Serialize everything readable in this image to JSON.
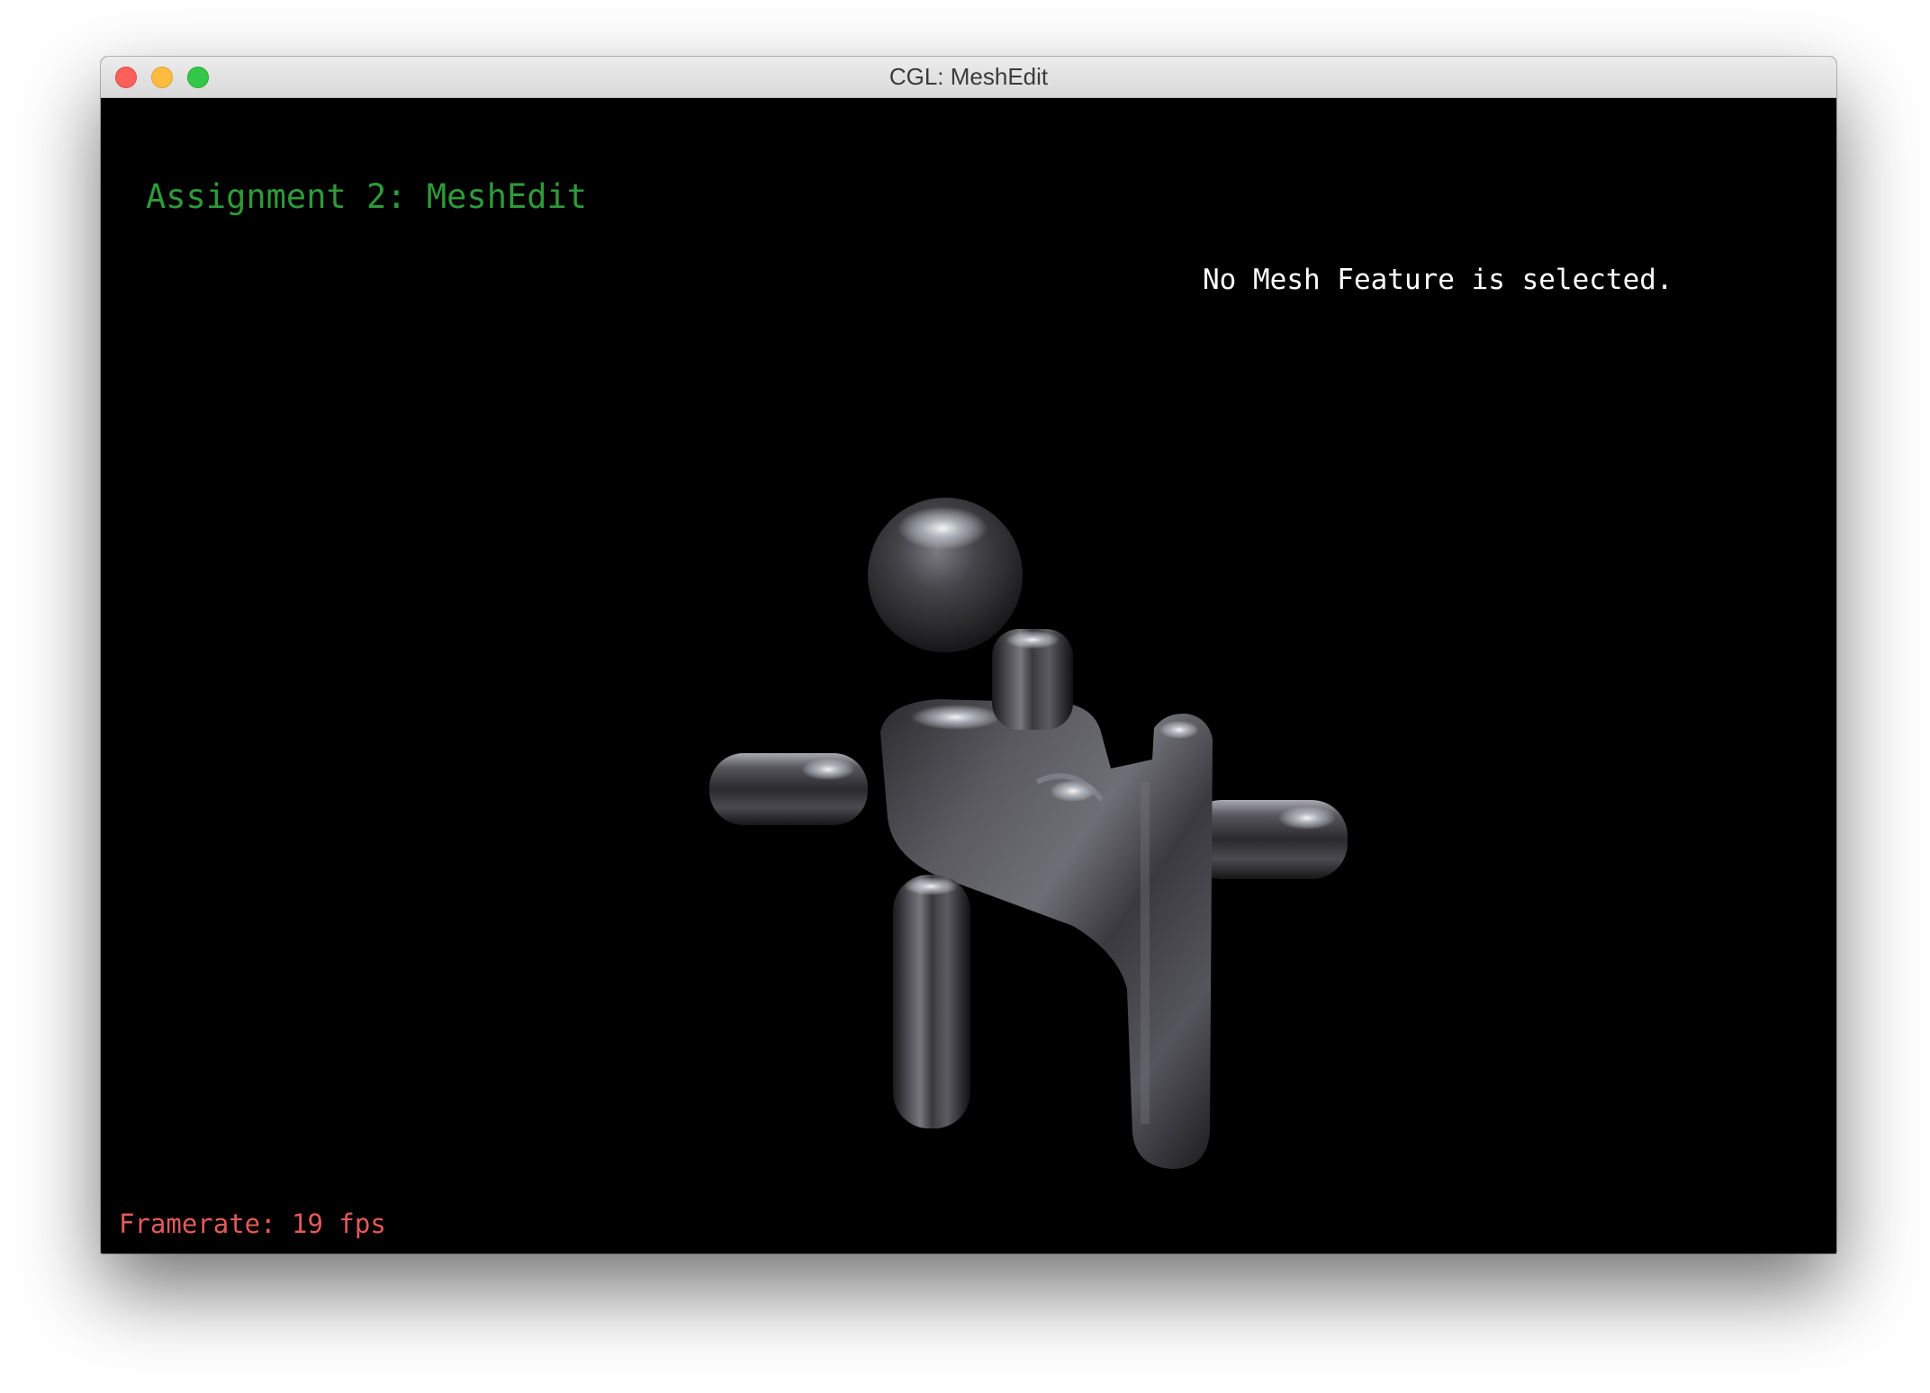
{
  "window": {
    "title": "CGL: MeshEdit"
  },
  "viewport": {
    "assignment_title": "Assignment 2: MeshEdit",
    "selection_status": "No Mesh Feature is selected.",
    "framerate": "Framerate: 19 fps",
    "mesh_material": "chrome-environment-mapped"
  },
  "colors": {
    "title_green": "#2e9a3a",
    "framerate_red": "#e35a5a",
    "status_white": "#ffffff",
    "background": "#000000"
  }
}
